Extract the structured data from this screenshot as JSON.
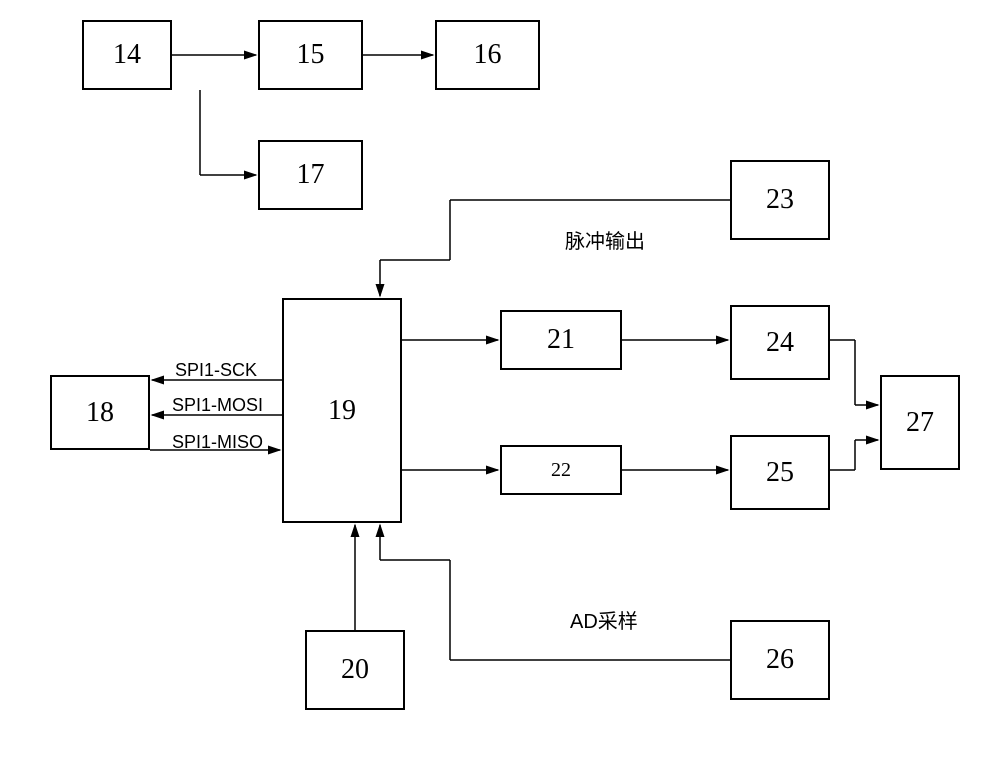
{
  "boxes": {
    "b14": "14",
    "b15": "15",
    "b16": "16",
    "b17": "17",
    "b18": "18",
    "b19": "19",
    "b20": "20",
    "b21": "21",
    "b22": "22",
    "b23": "23",
    "b24": "24",
    "b25": "25",
    "b26": "26",
    "b27": "27"
  },
  "labels": {
    "spi_sck": "SPI1-SCK",
    "spi_mosi": "SPI1-MOSI",
    "spi_miso": "SPI1-MISO",
    "pulse_out": "脉冲输出",
    "ad_sample": "AD采样"
  }
}
